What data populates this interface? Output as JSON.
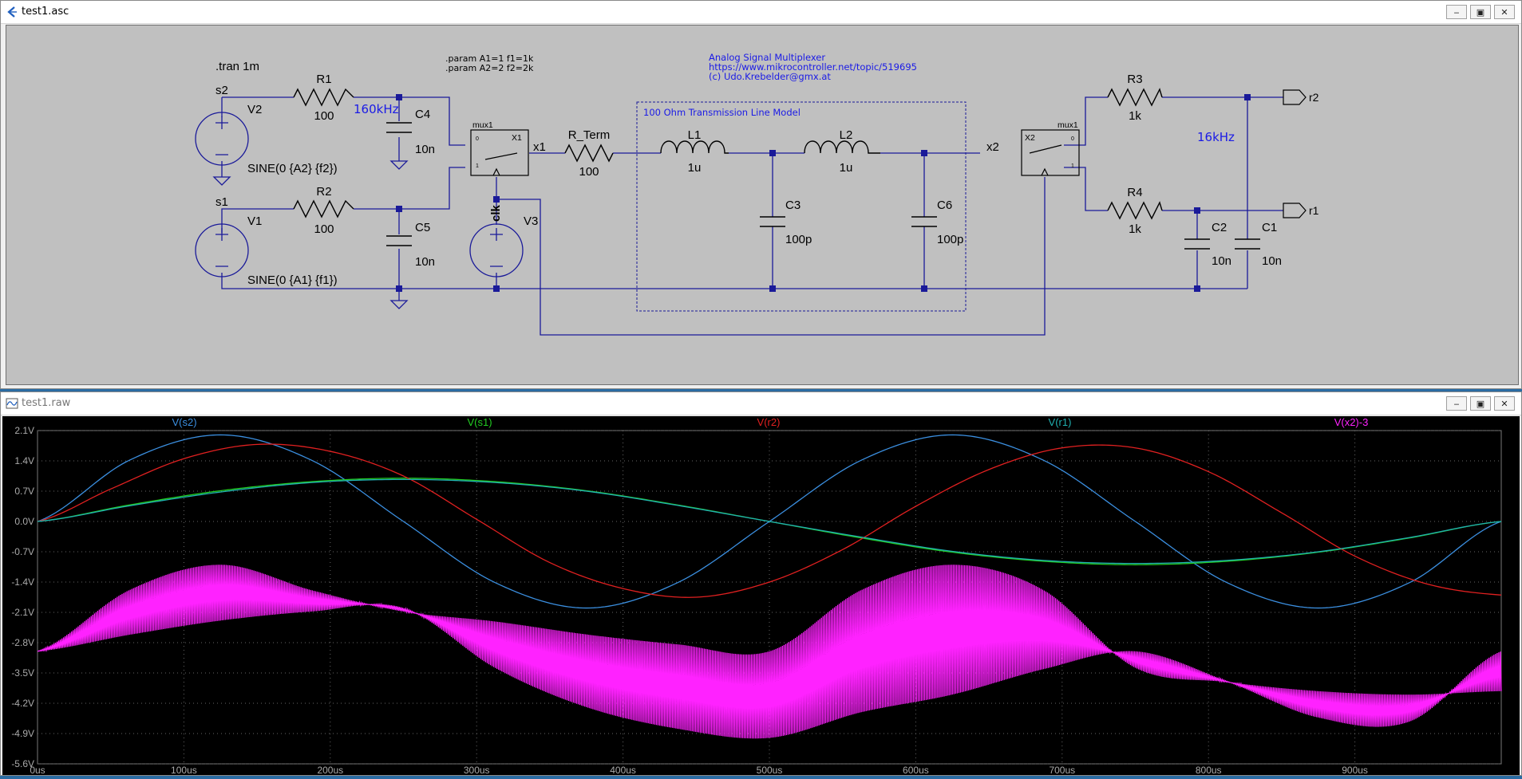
{
  "schematic_window": {
    "title": "test1.asc",
    "directives": {
      "tran": ".tran 1m",
      "param1": ".param A1=1 f1=1k",
      "param2": ".param A2=2 f2=2k"
    },
    "comment": {
      "line1": "Analog Signal Multiplexer",
      "line2": "https://www.mikrocontroller.net/topic/519695",
      "line3": "(c) Udo.Krebelder@gmx.at"
    },
    "tline_label": "100 Ohm Transmission Line Model",
    "freq_note_left": "160kHz",
    "freq_note_right": "16kHz",
    "nets": {
      "s2": "s2",
      "s1": "s1",
      "x1": "x1",
      "x2": "x2",
      "clk": "clk",
      "r2": "r2",
      "r1": "r1"
    },
    "components": {
      "V2": {
        "name": "V2",
        "value": "SINE(0 {A2} {f2})"
      },
      "V1": {
        "name": "V1",
        "value": "SINE(0 {A1} {f1})"
      },
      "V3": {
        "name": "V3"
      },
      "R1": {
        "name": "R1",
        "value": "100"
      },
      "R2": {
        "name": "R2",
        "value": "100"
      },
      "R_Term": {
        "name": "R_Term",
        "value": "100"
      },
      "R3": {
        "name": "R3",
        "value": "1k"
      },
      "R4": {
        "name": "R4",
        "value": "1k"
      },
      "C4": {
        "name": "C4",
        "value": "10n"
      },
      "C5": {
        "name": "C5",
        "value": "10n"
      },
      "C3": {
        "name": "C3",
        "value": "100p"
      },
      "C6": {
        "name": "C6",
        "value": "100p"
      },
      "C2": {
        "name": "C2",
        "value": "10n"
      },
      "C1": {
        "name": "C1",
        "value": "10n"
      },
      "L1": {
        "name": "L1",
        "value": "1u"
      },
      "L2": {
        "name": "L2",
        "value": "1u"
      },
      "X1": {
        "name": "X1",
        "model": "mux1"
      },
      "X2": {
        "name": "X2",
        "model": "mux1"
      }
    },
    "mux_pins": {
      "p0": "0",
      "p1": "1"
    }
  },
  "plot_window": {
    "title": "test1.raw"
  },
  "window_buttons": {
    "minimize": "‒",
    "restore": "▣",
    "close": "✕"
  },
  "chart_data": {
    "type": "line",
    "xlabel": "",
    "ylabel": "",
    "x_unit": "us",
    "xlim": [
      0,
      1000
    ],
    "ylim": [
      -5.6,
      2.1
    ],
    "x_ticks": [
      "0us",
      "100us",
      "200us",
      "300us",
      "400us",
      "500us",
      "600us",
      "700us",
      "800us",
      "900us"
    ],
    "y_ticks": [
      "2.1V",
      "1.4V",
      "0.7V",
      "0.0V",
      "-0.7V",
      "-1.4V",
      "-2.1V",
      "-2.8V",
      "-3.5V",
      "-4.2V",
      "-4.9V",
      "-5.6V"
    ],
    "grid": true,
    "series": [
      {
        "name": "V(s2)",
        "color": "#3b8fe0",
        "x": [
          0,
          62.5,
          125,
          187.5,
          250,
          312.5,
          375,
          437.5,
          500,
          562.5,
          625,
          687.5,
          750,
          812.5,
          875,
          937.5,
          1000
        ],
        "y": [
          0,
          1.41,
          2,
          1.41,
          0,
          -1.41,
          -2,
          -1.41,
          0,
          1.41,
          2,
          1.41,
          0,
          -1.41,
          -2,
          -1.41,
          0
        ]
      },
      {
        "name": "V(s1)",
        "color": "#22cc22",
        "x": [
          0,
          62.5,
          125,
          187.5,
          250,
          312.5,
          375,
          437.5,
          500,
          562.5,
          625,
          687.5,
          750,
          812.5,
          875,
          937.5,
          1000
        ],
        "y": [
          0,
          0.38,
          0.71,
          0.92,
          1,
          0.92,
          0.71,
          0.38,
          0,
          -0.38,
          -0.71,
          -0.92,
          -1,
          -0.92,
          -0.71,
          -0.38,
          0
        ]
      },
      {
        "name": "V(r2)",
        "color": "#e02020",
        "x": [
          0,
          50,
          100,
          150,
          200,
          250,
          300,
          350,
          400,
          450,
          500,
          550,
          600,
          650,
          700,
          750,
          800,
          850,
          900,
          950,
          1000
        ],
        "y": [
          0,
          0.75,
          1.45,
          1.78,
          1.62,
          1.05,
          0.05,
          -0.95,
          -1.55,
          -1.75,
          -1.4,
          -0.65,
          0.35,
          1.2,
          1.7,
          1.7,
          1.15,
          0.2,
          -0.8,
          -1.45,
          -1.7
        ]
      },
      {
        "name": "V(r1)",
        "color": "#20b0b0",
        "x": [
          0,
          62.5,
          125,
          187.5,
          250,
          312.5,
          375,
          437.5,
          500,
          562.5,
          625,
          687.5,
          750,
          812.5,
          875,
          937.5,
          1000
        ],
        "y": [
          0,
          0.36,
          0.68,
          0.9,
          0.97,
          0.9,
          0.7,
          0.37,
          0,
          -0.36,
          -0.69,
          -0.9,
          -0.97,
          -0.9,
          -0.7,
          -0.37,
          0
        ]
      },
      {
        "name": "V(x2)-3",
        "color": "#ff22ff",
        "envelope": true,
        "x": [
          0,
          62.5,
          125,
          187.5,
          250,
          312.5,
          375,
          437.5,
          500,
          562.5,
          625,
          687.5,
          750,
          812.5,
          875,
          937.5,
          1000
        ],
        "y_upper": [
          -3,
          -1.59,
          -1,
          -1.59,
          -2.08,
          -2.31,
          -2.61,
          -2.84,
          -3,
          -1.59,
          -1,
          -1.59,
          -3.38,
          -3.71,
          -3.92,
          -4,
          -3.92
        ],
        "y_lower": [
          -3,
          -2.62,
          -2.29,
          -2.08,
          -2,
          -3.38,
          -4.29,
          -4.79,
          -5,
          -4.41,
          -4,
          -3.41,
          -3,
          -3.69,
          -4.53,
          -4.62,
          -3.0
        ]
      }
    ]
  }
}
